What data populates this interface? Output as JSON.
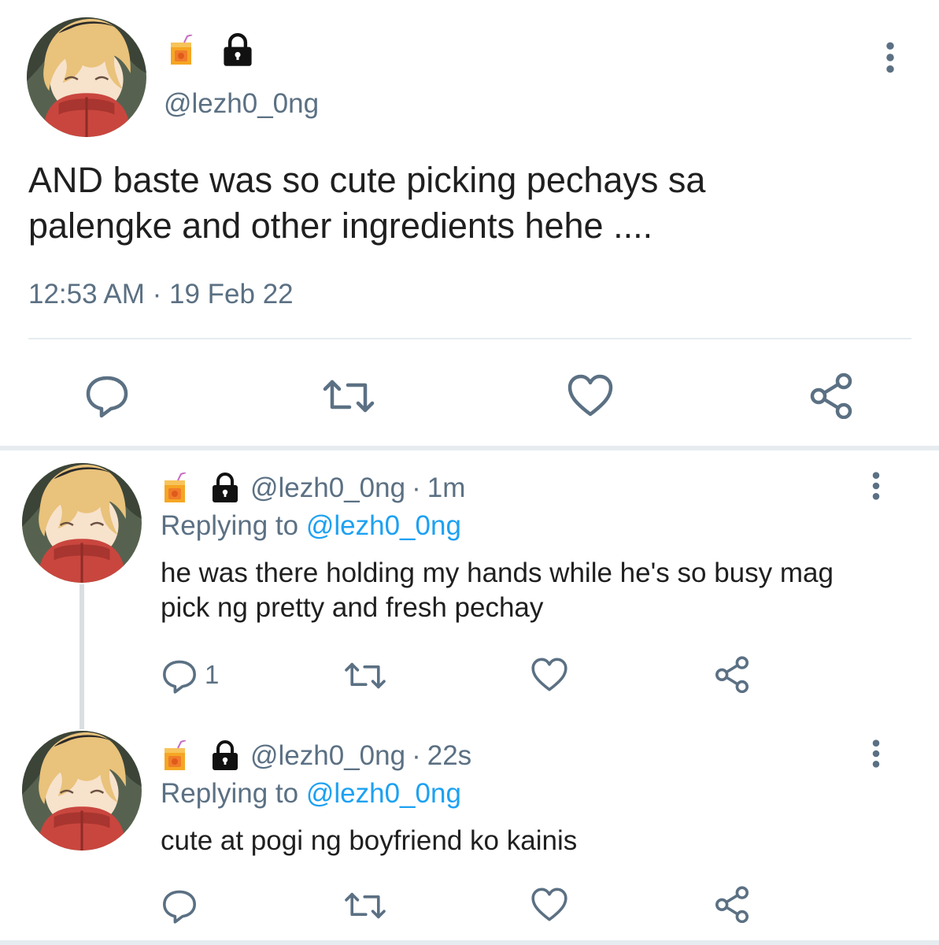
{
  "main_tweet": {
    "name_icons": [
      "juice-box-icon",
      "lock-icon"
    ],
    "handle": "@lezh0_0ng",
    "text_line1": "AND baste was so cute picking pechays sa",
    "text_line2": "palengke and other ingredients hehe ....",
    "time": "12:53 AM",
    "separator": "·",
    "date": "19 Feb 22",
    "actions": [
      "reply-icon",
      "retweet-icon",
      "like-icon",
      "share-icon"
    ]
  },
  "replies": [
    {
      "handle": "@lezh0_0ng",
      "separator": "·",
      "time": "1m",
      "replying_label": "Replying to",
      "replying_to": "@lezh0_0ng",
      "text_line1": "he was there holding my hands while he's so busy mag",
      "text_line2": "pick ng pretty and fresh pechay",
      "reply_count": "1"
    },
    {
      "handle": "@lezh0_0ng",
      "separator": "·",
      "time": "22s",
      "replying_label": "Replying to",
      "replying_to": "@lezh0_0ng",
      "text_line1": "cute at pogi ng boyfriend ko kainis",
      "reply_count": ""
    }
  ],
  "colors": {
    "muted": "#5b7083",
    "link": "#1da1f2",
    "icon": "#5b7083",
    "divider": "#e6ecf0"
  }
}
